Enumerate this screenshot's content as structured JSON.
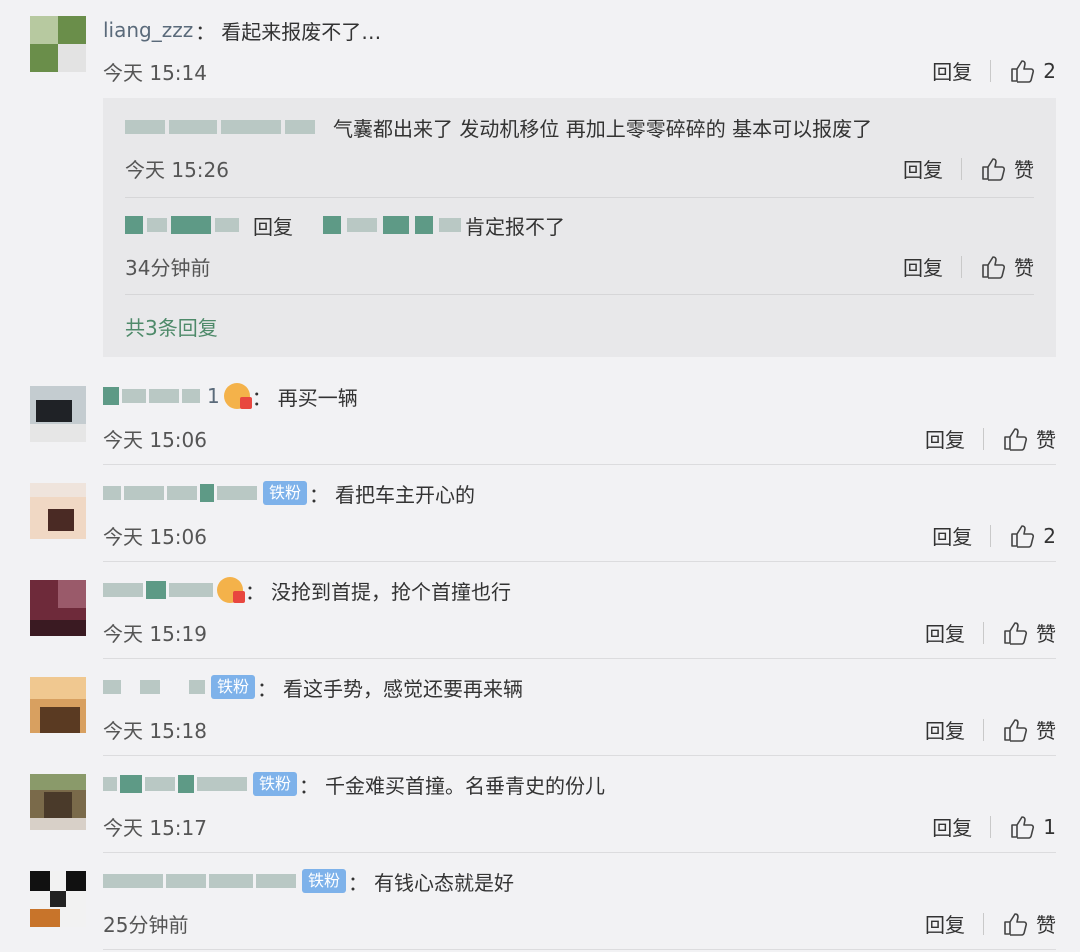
{
  "reply_label": "回复",
  "like_label": "赞",
  "colon": "：",
  "comments": [
    {
      "name": "liang_zzz",
      "text": "看起来报废不了…",
      "time": "今天 15:14",
      "likes": "2",
      "badge": ""
    },
    {
      "name": "",
      "text": "再买一辆",
      "time": "今天 15:06",
      "likes": "赞",
      "badge": "",
      "suffix": "1"
    },
    {
      "name": "",
      "text": "看把车主开心的",
      "time": "今天 15:06",
      "likes": "2",
      "badge": "铁粉"
    },
    {
      "name": "",
      "text": "没抢到首提，抢个首撞也行",
      "time": "今天 15:19",
      "likes": "赞",
      "badge": ""
    },
    {
      "name": "",
      "text": "看这手势，感觉还要再来辆",
      "time": "今天 15:18",
      "likes": "赞",
      "badge": "铁粉"
    },
    {
      "name": "",
      "text": "千金难买首撞。名垂青史的份儿",
      "time": "今天 15:17",
      "likes": "1",
      "badge": "铁粉"
    },
    {
      "name": "",
      "text": "有钱心态就是好",
      "time": "25分钟前",
      "likes": "赞",
      "badge": "铁粉"
    }
  ],
  "replies": [
    {
      "text": "气囊都出来了 发动机移位 再加上零零碎碎的 基本可以报废了",
      "time": "今天 15:26",
      "likes": "赞"
    },
    {
      "reply_word": "回复",
      "text": "肯定报不了",
      "time": "34分钟前",
      "likes": "赞"
    }
  ],
  "total_replies": "共3条回复",
  "colors": {
    "background": "#f2f2f4",
    "reply_box": "#e8e8ea",
    "badge": "#7eb2ea",
    "link_green": "#4e8a6a"
  },
  "icons": [
    "thumb-up-icon",
    "vip-crown-icon"
  ]
}
